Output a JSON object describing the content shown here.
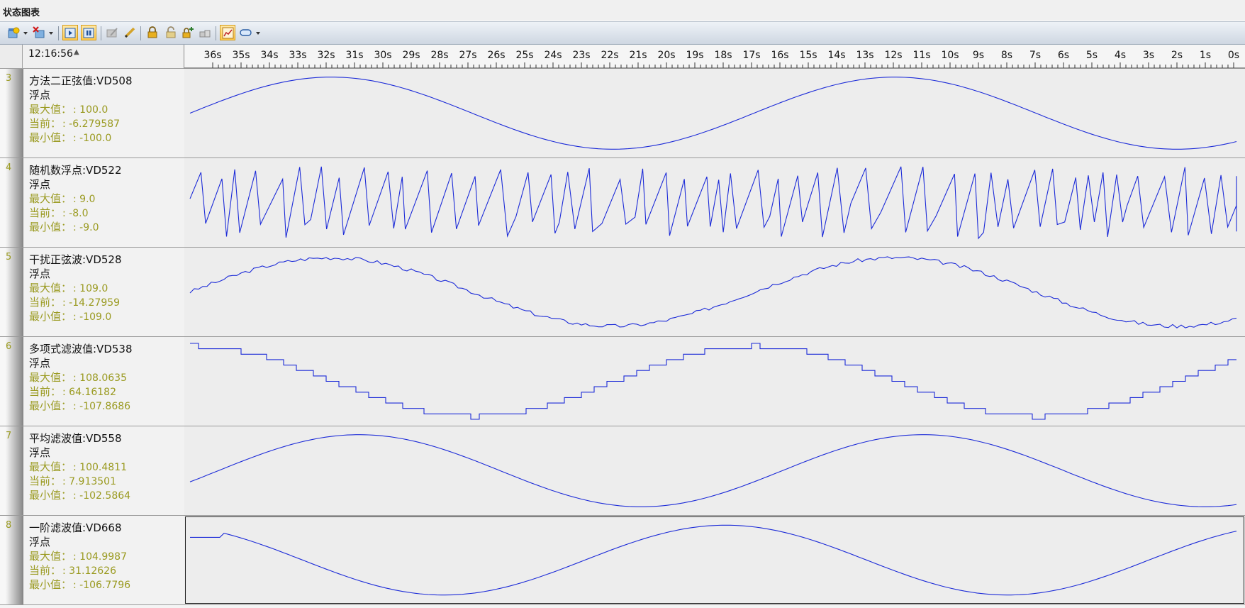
{
  "window": {
    "title": "状态图表"
  },
  "toolbar": {
    "icons": [
      "add-chart-icon",
      "remove-chart-icon",
      "play-icon",
      "pause-icon",
      "edit-disabled-icon",
      "pencil-icon",
      "lock-icon",
      "unlock-icon",
      "lock-add-icon",
      "lock-multi-icon",
      "chart-options-icon",
      "tag-icon"
    ]
  },
  "header": {
    "time": "12:16:56",
    "sort_indicator": "▲",
    "ticks": [
      "36s",
      "35s",
      "34s",
      "33s",
      "32s",
      "31s",
      "30s",
      "29s",
      "28s",
      "27s",
      "26s",
      "25s",
      "24s",
      "23s",
      "22s",
      "21s",
      "20s",
      "19s",
      "18s",
      "17s",
      "16s",
      "15s",
      "14s",
      "13s",
      "12s",
      "11s",
      "10s",
      "9s",
      "8s",
      "7s",
      "6s",
      "5s",
      "4s",
      "3s",
      "2s",
      "1s",
      "0s"
    ]
  },
  "labels": {
    "max": "最大值：",
    "current": "当前：",
    "min": "最小值："
  },
  "traces": [
    {
      "index": "3",
      "name": "方法二正弦值:VD508",
      "type": "浮点",
      "max": ": 100.0",
      "current": ": -6.279587",
      "min": ": -100.0",
      "kind": "sine",
      "vmin": -100,
      "vmax": 100,
      "start": -30,
      "period": 19.4,
      "amp": 0.95,
      "phase": 50
    },
    {
      "index": "4",
      "name": "随机数浮点:VD522",
      "type": "浮点",
      "max": ": 9.0",
      "current": ": -8.0",
      "min": ": -9.0",
      "kind": "random",
      "vmin": -9,
      "vmax": 9,
      "seed": 7
    },
    {
      "index": "5",
      "name": "干扰正弦波:VD528",
      "type": "浮点",
      "max": ": 109.0",
      "current": ": -14.27959",
      "min": ": -109.0",
      "kind": "noisy",
      "vmin": -109,
      "vmax": 109,
      "start": -30,
      "period": 19.4,
      "amp": 0.9,
      "phase": 50,
      "seed": 3
    },
    {
      "index": "6",
      "name": "多项式滤波值:VD538",
      "type": "浮点",
      "max": ": 108.0635",
      "current": ": 64.16182",
      "min": ": -107.8686",
      "kind": "stair",
      "vmin": -107.8686,
      "vmax": 108.0635,
      "start": 40,
      "period": 19.4,
      "amp": 0.93,
      "phase": 75
    },
    {
      "index": "7",
      "name": "平均滤波值:VD558",
      "type": "浮点",
      "max": ": 100.4811",
      "current": ": 7.913501",
      "min": ": -102.5864",
      "kind": "sine",
      "vmin": -102.5864,
      "vmax": 100.4811,
      "start": -50,
      "period": 19.4,
      "amp": 0.95,
      "phase": 45
    },
    {
      "index": "8",
      "name": "一阶滤波值:VD668",
      "type": "浮点",
      "max": ": 104.9987",
      "current": ": 31.12626",
      "min": ": -106.7796",
      "kind": "lag",
      "vmin": -106.7796,
      "vmax": 104.9987,
      "start": 0,
      "period": 19.4,
      "amp": 0.92,
      "phase": 80
    }
  ]
}
